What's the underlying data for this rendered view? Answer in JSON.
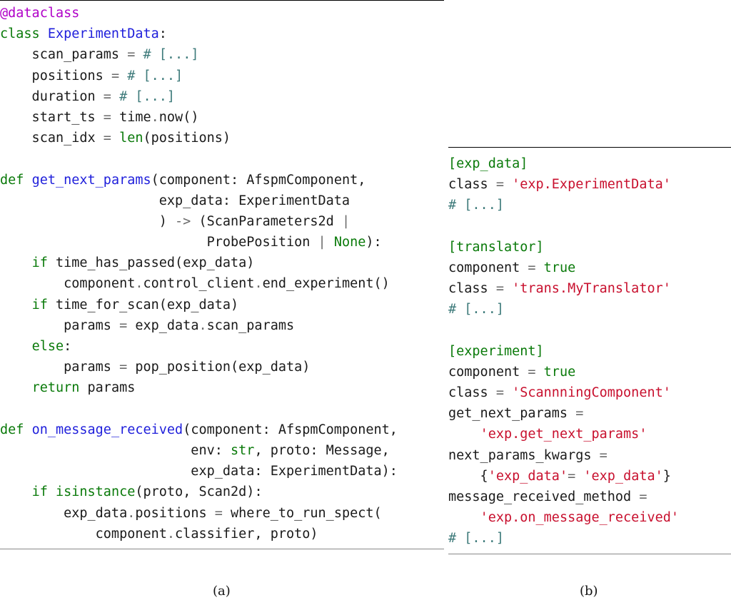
{
  "colors": {
    "keyword": "#0a7a0a",
    "function_name": "#1f1fdb",
    "decorator": "#b000c8",
    "string": "#c8102e",
    "comment": "#3d7a7a",
    "operator": "#6a6a6a",
    "text": "#1a1a1a",
    "section_header": "#0a7a0a"
  },
  "panel_a": {
    "caption": "(a)",
    "lines": [
      [
        {
          "t": "@dataclass",
          "c": "decorator"
        }
      ],
      [
        {
          "t": "class ",
          "c": "keyword"
        },
        {
          "t": "ExperimentData",
          "c": "function_name"
        },
        {
          "t": ":",
          "c": "text"
        }
      ],
      [
        {
          "t": "    scan_params ",
          "c": "text"
        },
        {
          "t": "=",
          "c": "operator"
        },
        {
          "t": " ",
          "c": "text"
        },
        {
          "t": "# [...]",
          "c": "comment"
        }
      ],
      [
        {
          "t": "    positions ",
          "c": "text"
        },
        {
          "t": "=",
          "c": "operator"
        },
        {
          "t": " ",
          "c": "text"
        },
        {
          "t": "# [...]",
          "c": "comment"
        }
      ],
      [
        {
          "t": "    duration ",
          "c": "text"
        },
        {
          "t": "=",
          "c": "operator"
        },
        {
          "t": " ",
          "c": "text"
        },
        {
          "t": "# [...]",
          "c": "comment"
        }
      ],
      [
        {
          "t": "    start_ts ",
          "c": "text"
        },
        {
          "t": "=",
          "c": "operator"
        },
        {
          "t": " time",
          "c": "text"
        },
        {
          "t": ".",
          "c": "operator"
        },
        {
          "t": "now()",
          "c": "text"
        }
      ],
      [
        {
          "t": "    scan_idx ",
          "c": "text"
        },
        {
          "t": "=",
          "c": "operator"
        },
        {
          "t": " ",
          "c": "text"
        },
        {
          "t": "len",
          "c": "keyword"
        },
        {
          "t": "(positions)",
          "c": "text"
        }
      ],
      [
        {
          "t": "",
          "c": "text"
        }
      ],
      [
        {
          "t": "def ",
          "c": "keyword"
        },
        {
          "t": "get_next_params",
          "c": "function_name"
        },
        {
          "t": "(component: AfspmComponent,",
          "c": "text"
        }
      ],
      [
        {
          "t": "                    exp_data: ExperimentData",
          "c": "text"
        }
      ],
      [
        {
          "t": "                    ) ",
          "c": "text"
        },
        {
          "t": "->",
          "c": "operator"
        },
        {
          "t": " (ScanParameters2d ",
          "c": "text"
        },
        {
          "t": "|",
          "c": "operator"
        }
      ],
      [
        {
          "t": "                          ProbePosition ",
          "c": "text"
        },
        {
          "t": "|",
          "c": "operator"
        },
        {
          "t": " ",
          "c": "text"
        },
        {
          "t": "None",
          "c": "keyword"
        },
        {
          "t": "):",
          "c": "text"
        }
      ],
      [
        {
          "t": "    ",
          "c": "text"
        },
        {
          "t": "if",
          "c": "keyword"
        },
        {
          "t": " time_has_passed(exp_data)",
          "c": "text"
        }
      ],
      [
        {
          "t": "        component",
          "c": "text"
        },
        {
          "t": ".",
          "c": "operator"
        },
        {
          "t": "control_client",
          "c": "text"
        },
        {
          "t": ".",
          "c": "operator"
        },
        {
          "t": "end_experiment()",
          "c": "text"
        }
      ],
      [
        {
          "t": "    ",
          "c": "text"
        },
        {
          "t": "if",
          "c": "keyword"
        },
        {
          "t": " time_for_scan(exp_data)",
          "c": "text"
        }
      ],
      [
        {
          "t": "        params ",
          "c": "text"
        },
        {
          "t": "=",
          "c": "operator"
        },
        {
          "t": " exp_data",
          "c": "text"
        },
        {
          "t": ".",
          "c": "operator"
        },
        {
          "t": "scan_params",
          "c": "text"
        }
      ],
      [
        {
          "t": "    ",
          "c": "text"
        },
        {
          "t": "else",
          "c": "keyword"
        },
        {
          "t": ":",
          "c": "text"
        }
      ],
      [
        {
          "t": "        params ",
          "c": "text"
        },
        {
          "t": "=",
          "c": "operator"
        },
        {
          "t": " pop_position(exp_data)",
          "c": "text"
        }
      ],
      [
        {
          "t": "    ",
          "c": "text"
        },
        {
          "t": "return",
          "c": "keyword"
        },
        {
          "t": " params",
          "c": "text"
        }
      ],
      [
        {
          "t": "",
          "c": "text"
        }
      ],
      [
        {
          "t": "def ",
          "c": "keyword"
        },
        {
          "t": "on_message_received",
          "c": "function_name"
        },
        {
          "t": "(component: AfspmComponent,",
          "c": "text"
        }
      ],
      [
        {
          "t": "                        env: ",
          "c": "text"
        },
        {
          "t": "str",
          "c": "keyword"
        },
        {
          "t": ", proto: Message,",
          "c": "text"
        }
      ],
      [
        {
          "t": "                        exp_data: ExperimentData):",
          "c": "text"
        }
      ],
      [
        {
          "t": "    ",
          "c": "text"
        },
        {
          "t": "if",
          "c": "keyword"
        },
        {
          "t": " ",
          "c": "text"
        },
        {
          "t": "isinstance",
          "c": "keyword"
        },
        {
          "t": "(proto, Scan2d):",
          "c": "text"
        }
      ],
      [
        {
          "t": "        exp_data",
          "c": "text"
        },
        {
          "t": ".",
          "c": "operator"
        },
        {
          "t": "positions ",
          "c": "text"
        },
        {
          "t": "=",
          "c": "operator"
        },
        {
          "t": " where_to_run_spect(",
          "c": "text"
        }
      ],
      [
        {
          "t": "            component",
          "c": "text"
        },
        {
          "t": ".",
          "c": "operator"
        },
        {
          "t": "classifier, proto)",
          "c": "text"
        }
      ]
    ]
  },
  "panel_b": {
    "caption": "(b)",
    "lines": [
      [
        {
          "t": "[exp_data]",
          "c": "section_header"
        }
      ],
      [
        {
          "t": "class ",
          "c": "text"
        },
        {
          "t": "=",
          "c": "operator"
        },
        {
          "t": " ",
          "c": "text"
        },
        {
          "t": "'exp.ExperimentData'",
          "c": "string"
        }
      ],
      [
        {
          "t": "# [...]",
          "c": "comment"
        }
      ],
      [
        {
          "t": "",
          "c": "text"
        }
      ],
      [
        {
          "t": "[translator]",
          "c": "section_header"
        }
      ],
      [
        {
          "t": "component ",
          "c": "text"
        },
        {
          "t": "=",
          "c": "operator"
        },
        {
          "t": " ",
          "c": "text"
        },
        {
          "t": "true",
          "c": "keyword"
        }
      ],
      [
        {
          "t": "class ",
          "c": "text"
        },
        {
          "t": "=",
          "c": "operator"
        },
        {
          "t": " ",
          "c": "text"
        },
        {
          "t": "'trans.MyTranslator'",
          "c": "string"
        }
      ],
      [
        {
          "t": "# [...]",
          "c": "comment"
        }
      ],
      [
        {
          "t": "",
          "c": "text"
        }
      ],
      [
        {
          "t": "[experiment]",
          "c": "section_header"
        }
      ],
      [
        {
          "t": "component ",
          "c": "text"
        },
        {
          "t": "=",
          "c": "operator"
        },
        {
          "t": " ",
          "c": "text"
        },
        {
          "t": "true",
          "c": "keyword"
        }
      ],
      [
        {
          "t": "class ",
          "c": "text"
        },
        {
          "t": "=",
          "c": "operator"
        },
        {
          "t": " ",
          "c": "text"
        },
        {
          "t": "'ScannningComponent'",
          "c": "string"
        }
      ],
      [
        {
          "t": "get_next_params ",
          "c": "text"
        },
        {
          "t": "=",
          "c": "operator"
        }
      ],
      [
        {
          "t": "    ",
          "c": "text"
        },
        {
          "t": "'exp.get_next_params'",
          "c": "string"
        }
      ],
      [
        {
          "t": "next_params_kwargs ",
          "c": "text"
        },
        {
          "t": "=",
          "c": "operator"
        }
      ],
      [
        {
          "t": "    {",
          "c": "text"
        },
        {
          "t": "'exp_data'",
          "c": "string"
        },
        {
          "t": "= ",
          "c": "operator"
        },
        {
          "t": "'exp_data'",
          "c": "string"
        },
        {
          "t": "}",
          "c": "text"
        }
      ],
      [
        {
          "t": "message_received_method ",
          "c": "text"
        },
        {
          "t": "=",
          "c": "operator"
        }
      ],
      [
        {
          "t": "    ",
          "c": "text"
        },
        {
          "t": "'exp.on_message_received'",
          "c": "string"
        }
      ],
      [
        {
          "t": "# [...]",
          "c": "comment"
        }
      ]
    ]
  }
}
